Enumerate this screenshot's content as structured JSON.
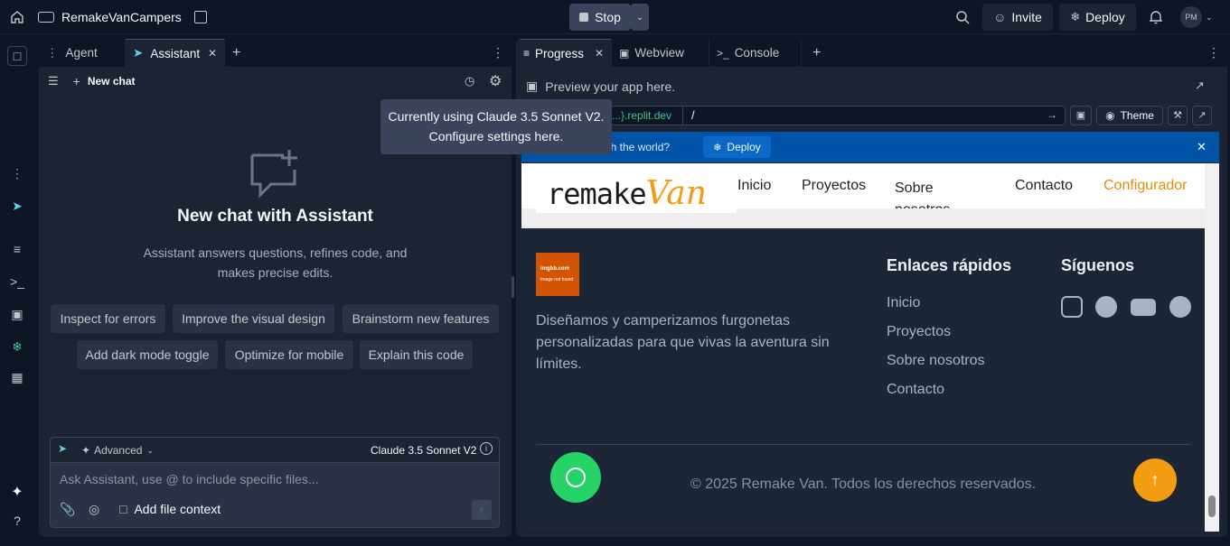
{
  "topbar": {
    "repl_name": "RemakeVanCampers",
    "stop_label": "Stop",
    "invite_label": "Invite",
    "deploy_label": "Deploy",
    "avatar_initials": "PM"
  },
  "left_panel": {
    "tabs": [
      {
        "label": "Agent"
      },
      {
        "label": "Assistant"
      }
    ],
    "new_chat_label": "New chat",
    "empty_title": "New chat with Assistant",
    "empty_desc_line1": "Assistant answers questions, refines code, and",
    "empty_desc_line2": "makes precise edits.",
    "suggestions": [
      "Inspect for errors",
      "Improve the visual design",
      "Brainstorm new features",
      "Add dark mode toggle",
      "Optimize for mobile",
      "Explain this code"
    ],
    "composer": {
      "advanced_label": "Advanced",
      "model_label": "Claude 3.5 Sonnet V2",
      "placeholder": "Ask Assistant, use @ to include specific files...",
      "add_context_label": "Add file context"
    }
  },
  "tooltip": {
    "line1": "Currently using Claude 3.5 Sonnet V2.",
    "line2": "Configure settings here."
  },
  "right_panel": {
    "tabs": [
      {
        "label": "Progress"
      },
      {
        "label": "Webview"
      },
      {
        "label": "Console"
      }
    ],
    "preview_hint": "Preview your app here.",
    "url_domain": "...}.replit.dev",
    "url_path": "/",
    "theme_label": "Theme",
    "banner_text": "re with the world?",
    "banner_deploy": "Deploy"
  },
  "site": {
    "logo_text_dark": "remake",
    "logo_text_accent": "Van",
    "nav": [
      "Inicio",
      "Proyectos",
      "Sobre nosotros",
      "Contacto",
      "Configurador"
    ],
    "img_placeholder_line1": "imgbb.com",
    "img_placeholder_line2": "Image not found",
    "description": "Diseñamos y camperizamos furgonetas personalizadas para que vivas la aventura sin límites.",
    "quick_links_title": "Enlaces rápidos",
    "quick_links": [
      "Inicio",
      "Proyectos",
      "Sobre nosotros",
      "Contacto"
    ],
    "follow_title": "Síguenos",
    "social_icons": [
      "instagram-icon",
      "facebook-icon",
      "youtube-icon",
      "pinterest-icon"
    ],
    "copyright": "© 2025 Remake Van. Todos los derechos reservados."
  },
  "colors": {
    "accent_orange": "#f39c12",
    "whatsapp_green": "#25d366",
    "banner_blue": "#0053a6"
  }
}
